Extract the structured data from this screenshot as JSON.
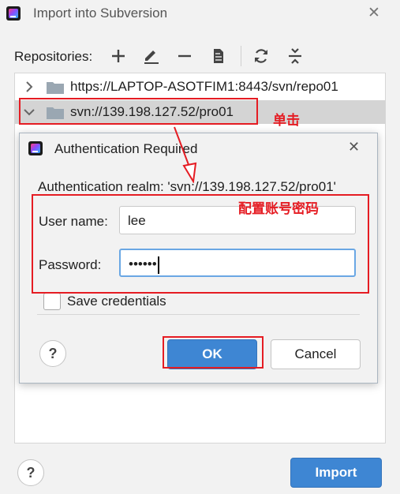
{
  "window": {
    "title": "Import into Subversion"
  },
  "toolbar": {
    "label": "Repositories:"
  },
  "repositories": [
    {
      "url": "https://LAPTOP-ASOTFIM1:8443/svn/repo01",
      "expanded": false,
      "selected": false
    },
    {
      "url": "svn://139.198.127.52/pro01",
      "expanded": true,
      "selected": true
    }
  ],
  "auth_dialog": {
    "title": "Authentication Required",
    "realm": "Authentication realm: 'svn://139.198.127.52/pro01'",
    "username_label": "User name:",
    "username_value": "lee",
    "password_label": "Password:",
    "password_mask": "••••••",
    "save_label": "Save credentials",
    "ok_label": "OK",
    "cancel_label": "Cancel",
    "help_label": "?"
  },
  "footer": {
    "help_label": "?",
    "import_label": "Import"
  },
  "annotations": {
    "click_note": "单击",
    "credentials_note": "配置账号密码"
  },
  "colors": {
    "accent": "#3e86d3",
    "annotation": "#e51c23",
    "selected_row": "#d4d4d4"
  }
}
